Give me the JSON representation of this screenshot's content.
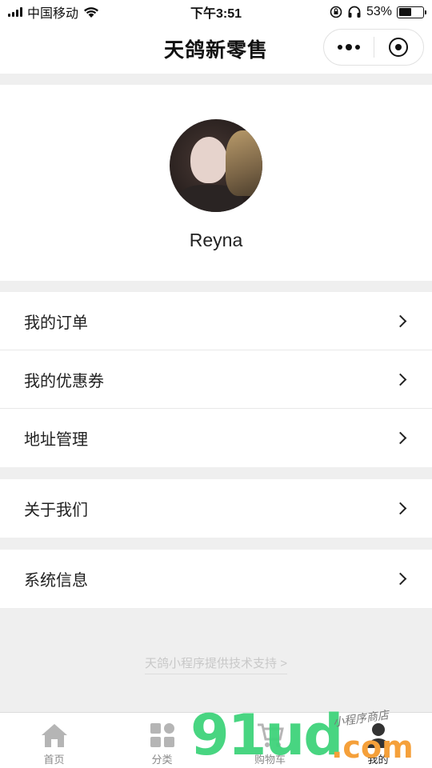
{
  "status_bar": {
    "carrier": "中国移动",
    "time": "下午3:51",
    "battery_percent": "53%",
    "battery_level": 0.53
  },
  "nav": {
    "title": "天鸽新零售"
  },
  "profile": {
    "username": "Reyna"
  },
  "menu_groups": [
    {
      "items": [
        {
          "label": "我的订单"
        },
        {
          "label": "我的优惠券"
        },
        {
          "label": "地址管理"
        }
      ]
    },
    {
      "items": [
        {
          "label": "关于我们"
        }
      ]
    },
    {
      "items": [
        {
          "label": "系统信息"
        }
      ]
    }
  ],
  "footer": {
    "support_link": "天鸽小程序提供技术支持 >"
  },
  "tab_bar": {
    "tabs": [
      {
        "label": "首页",
        "icon": "home-icon"
      },
      {
        "label": "分类",
        "icon": "category-icon"
      },
      {
        "label": "购物车",
        "icon": "cart-icon"
      },
      {
        "label": "我的",
        "icon": "user-icon",
        "active": true
      }
    ]
  },
  "watermark": {
    "brand": "91ud",
    "suffix": ".com",
    "slogan": "小程序商店"
  },
  "colors": {
    "background": "#efefef",
    "text": "#222222",
    "watermark_green": "#3fd37b",
    "watermark_orange": "#f5a03a"
  }
}
